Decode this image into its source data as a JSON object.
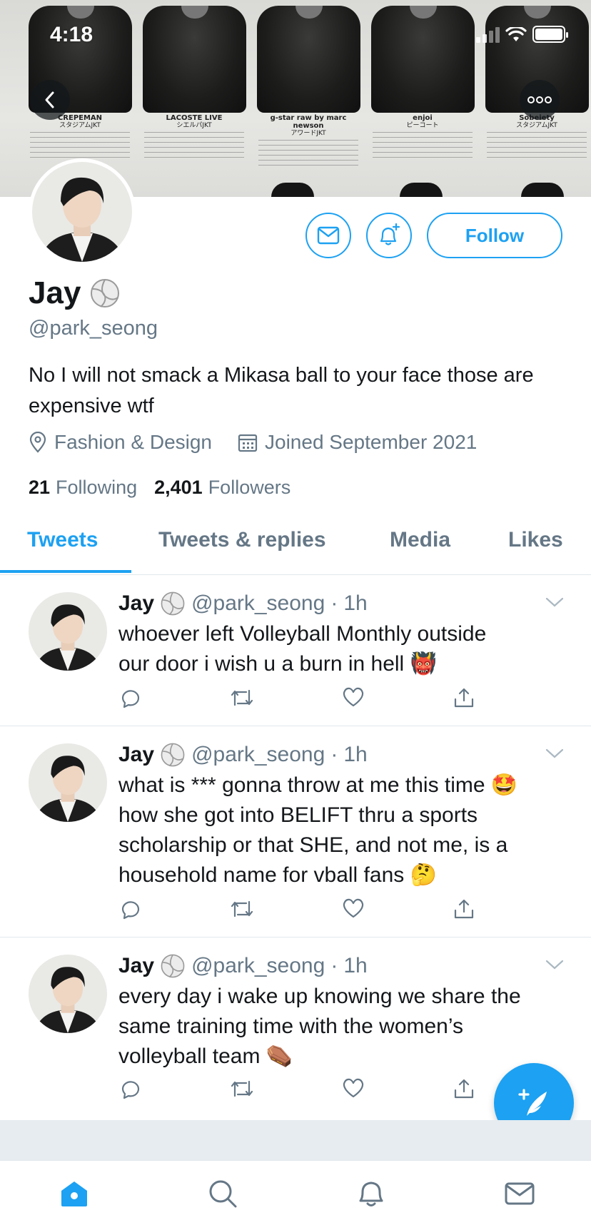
{
  "status_bar": {
    "time": "4:18"
  },
  "banner": {
    "captions": [
      {
        "brand": "CREPEMAN",
        "sub": "スタジアムJKT"
      },
      {
        "brand": "LACOSTE LIVE",
        "sub": "シエルパJKT"
      },
      {
        "brand": "g-star raw by marc newson",
        "sub": "アワードJKT"
      },
      {
        "brand": "enjoi",
        "sub": "ピーコート"
      },
      {
        "brand": "Sobeiety",
        "sub": "スタジアムJKT"
      }
    ]
  },
  "profile": {
    "name": "Jay",
    "handle": "@park_seong",
    "bio": "No I will not smack a Mikasa ball to your face those are expensive wtf",
    "category": "Fashion & Design",
    "joined": "Joined September 2021",
    "following_count": "21",
    "following_label": "Following",
    "followers_count": "2,401",
    "followers_label": "Followers",
    "follow_label": "Follow"
  },
  "tabs": [
    "Tweets",
    "Tweets & replies",
    "Media",
    "Likes"
  ],
  "tweets": [
    {
      "name": "Jay",
      "handle": "@park_seong",
      "time": "1h",
      "lines": [
        "whoever left Volleyball Monthly outside",
        "our door i wish u a burn in hell 👹"
      ]
    },
    {
      "name": "Jay",
      "handle": "@park_seong",
      "time": "1h",
      "lines": [
        "what is *** gonna throw at me this time 🤩",
        "how she got into BELIFT thru a sports",
        "scholarship or that SHE, and not me, is a",
        "household name for vball fans 🤔"
      ]
    },
    {
      "name": "Jay",
      "handle": "@park_seong",
      "time": "1h",
      "lines": [
        "every day i wake up knowing we share the",
        "same training time with the women’s",
        "volleyball team ⚰️"
      ]
    }
  ],
  "colors": {
    "accent": "#1da1f2",
    "secondary_text": "#657786",
    "divider": "#e1e8ed"
  },
  "icons": {
    "back": "chevron-left-icon",
    "more": "ellipsis-icon",
    "message": "envelope-icon",
    "notify": "bell-plus-icon",
    "location": "location-pin-icon",
    "calendar": "calendar-icon",
    "reply": "reply-icon",
    "retweet": "retweet-icon",
    "like": "heart-icon",
    "share": "share-icon",
    "compose": "compose-tweet-icon",
    "home": "home-icon",
    "search": "search-icon",
    "notifications": "bell-icon",
    "messages": "mail-icon"
  }
}
